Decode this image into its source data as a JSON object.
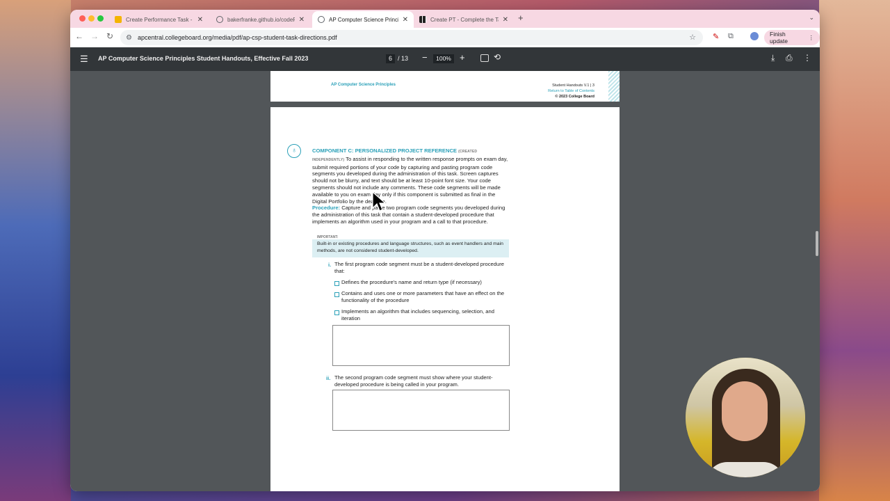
{
  "browser": {
    "tabs": [
      {
        "title": "Create Performance Task - G",
        "favicon_color": "#f4b400",
        "active": false
      },
      {
        "title": "bakerfranke.github.io/codeP",
        "favicon_color": "#5f6368",
        "active": false
      },
      {
        "title": "AP Computer Science Princip",
        "favicon_color": "#5f6368",
        "active": true
      },
      {
        "title": "Create PT - Complete the Ta",
        "favicon_color": "#222222",
        "active": false
      }
    ],
    "address": "apcentral.collegeboard.org/media/pdf/ap-csp-student-task-directions.pdf",
    "finish_update_label": "Finish update",
    "accent_tab_bar": "#f7d8e3"
  },
  "pdf": {
    "doc_title": "AP Computer Science Principles Student Handouts, Effective Fall 2023",
    "page_current": "6",
    "page_total": "/ 13",
    "zoom": "100%"
  },
  "prev_page": {
    "left_header": "AP Computer Science Principles",
    "right_line1": "Student Handouts  V.1  |  3",
    "right_line2": "Return to Table of Contents",
    "right_line3": "© 2023 College Board"
  },
  "page": {
    "heading": "COMPONENT C: PERSONALIZED PROJECT REFERENCE",
    "heading_note1": "(CREATED",
    "heading_note2": "INDEPENDENTLY)",
    "para1": "To assist in responding to the written response prompts on exam day, submit required portions of your code by capturing and pasting program code segments you developed during the administration of this task. Screen captures should not be blurry, and text should be at least 10-point font size. Your code segments should not include any comments. These code segments will be made available to you on exam day only if this component is submitted as final in the Digital Portfolio by the deadline.",
    "procedure_label": "Procedure:",
    "procedure_text": "Capture and paste two program code segments you developed during the administration of this task that contain a student-developed procedure that implements an algorithm used in your program and a call to that procedure.",
    "important_label": "IMPORTANT:",
    "important_text": "Built-in or existing procedures and language structures, such as event handlers and main methods, are not considered student-developed.",
    "item_i_numeral": "i.",
    "item_i_text": "The first program code segment must be a student-developed procedure that:",
    "checks": [
      "Defines the procedure's name and return type (if necessary)",
      "Contains and uses one or more parameters that have an effect on the functionality of the procedure",
      "Implements an algorithm that includes sequencing, selection, and iteration"
    ],
    "item_ii_numeral": "ii.",
    "item_ii_text": "The second program code segment must show where your student-developed procedure is being called in your program."
  }
}
